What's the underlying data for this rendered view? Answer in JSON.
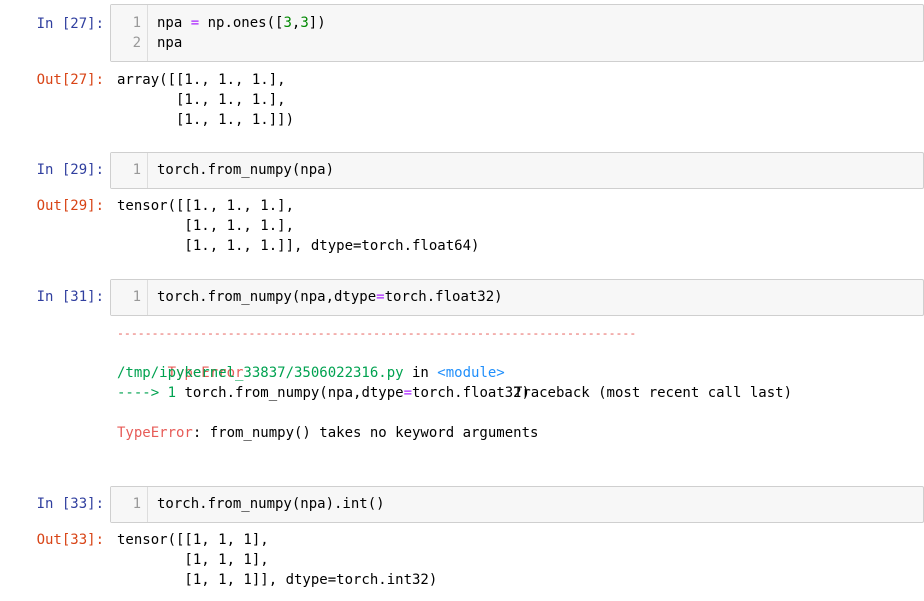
{
  "cells": [
    {
      "in_prompt": "In  [27]:",
      "code_lines": [
        {
          "num": "1",
          "parts": [
            {
              "t": "npa ",
              "c": ""
            },
            {
              "t": "=",
              "c": "op"
            },
            {
              "t": " np.ones([",
              "c": ""
            },
            {
              "t": "3",
              "c": "num"
            },
            {
              "t": ",",
              "c": ""
            },
            {
              "t": "3",
              "c": "num"
            },
            {
              "t": "])",
              "c": ""
            }
          ]
        },
        {
          "num": "2",
          "parts": [
            {
              "t": "npa",
              "c": ""
            }
          ]
        }
      ],
      "out_prompt": "Out[27]:",
      "output_lines": [
        "array([[1., 1., 1.],",
        "       [1., 1., 1.],",
        "       [1., 1., 1.]])"
      ]
    },
    {
      "in_prompt": "In  [29]:",
      "code_lines": [
        {
          "num": "1",
          "parts": [
            {
              "t": "torch.from_numpy(npa)",
              "c": ""
            }
          ]
        }
      ],
      "out_prompt": "Out[29]:",
      "output_lines": [
        "tensor([[1., 1., 1.],",
        "        [1., 1., 1.],",
        "        [1., 1., 1.]], dtype=torch.float64)"
      ]
    },
    {
      "in_prompt": "In  [31]:",
      "code_lines": [
        {
          "num": "1",
          "parts": [
            {
              "t": "torch.from_numpy(npa,dtype",
              "c": ""
            },
            {
              "t": "=",
              "c": "op"
            },
            {
              "t": "torch.float32)",
              "c": ""
            }
          ]
        }
      ],
      "error": {
        "dashes": "---------------------------------------------------------------------------",
        "type": "TypeError",
        "traceback_label": "Traceback (most recent call last)",
        "file": "/tmp/ipykernel_33837/3506022316.py",
        "in_word": " in ",
        "module": "<module>",
        "arrow": "----> 1 ",
        "arrow_code_a": "torch.from_numpy(npa,dtype",
        "arrow_code_eq": "=",
        "arrow_code_b": "torch.float32)",
        "message_type": "TypeError",
        "message": ": from_numpy() takes no keyword arguments"
      }
    },
    {
      "in_prompt": "In  [33]:",
      "code_lines": [
        {
          "num": "1",
          "parts": [
            {
              "t": "torch.from_numpy(npa).int()",
              "c": ""
            }
          ]
        }
      ],
      "out_prompt": "Out[33]:",
      "output_lines": [
        "tensor([[1, 1, 1],",
        "        [1, 1, 1],",
        "        [1, 1, 1]], dtype=torch.int32)"
      ]
    }
  ]
}
